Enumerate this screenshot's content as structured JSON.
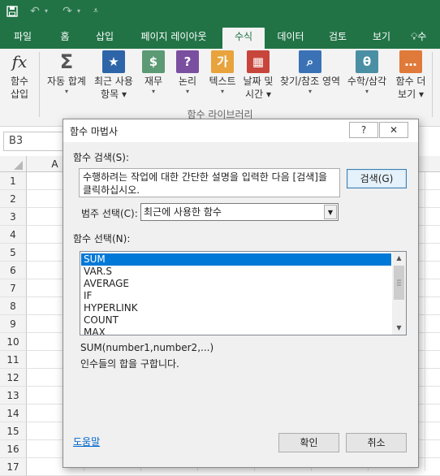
{
  "qat": {
    "save_icon": "save-icon",
    "undo_icon": "undo-icon",
    "redo_icon": "redo-icon"
  },
  "tabs": [
    "파일",
    "홈",
    "삽입",
    "페이지 레이아웃",
    "수식",
    "데이터",
    "검토",
    "보기",
    "수"
  ],
  "active_tab": "수식",
  "ribbon": {
    "insert_function": {
      "line1": "함수",
      "line2": "삽입",
      "icon": "fx"
    },
    "autosum": {
      "label": "자동 합계",
      "icon": "Σ"
    },
    "recent": {
      "line1": "최근 사용",
      "line2": "항목",
      "icon": "★"
    },
    "financial": {
      "label": "재무",
      "icon": "$"
    },
    "logical": {
      "label": "논리",
      "icon": "?"
    },
    "text": {
      "label": "텍스트",
      "icon": "가"
    },
    "datetime": {
      "line1": "날짜 및",
      "line2": "시간",
      "icon": "▦"
    },
    "lookup": {
      "label": "찾기/참조 영역",
      "icon": "⌕"
    },
    "math": {
      "label": "수학/삼각",
      "icon": "θ"
    },
    "more": {
      "line1": "함수 더",
      "line2": "보기",
      "icon": "…"
    },
    "group_label": "함수 라이브러리"
  },
  "namebox": {
    "value": "B3"
  },
  "sheet": {
    "column_a": "A",
    "rows": [
      "1",
      "2",
      "3",
      "4",
      "5",
      "6",
      "7",
      "8",
      "9",
      "10",
      "11",
      "12",
      "13",
      "14",
      "15",
      "16",
      "17"
    ]
  },
  "dialog": {
    "title": "함수 마법사",
    "help_button": "?",
    "close_button": "✕",
    "search_label": "함수 검색(S):",
    "search_desc": "수행하려는 작업에 대한 간단한 설명을 입력한 다음 [검색]을 클릭하십시오.",
    "search_button": "검색(G)",
    "category_label": "범주 선택(C):",
    "category_value": "최근에 사용한 함수",
    "function_label": "함수 선택(N):",
    "functions": [
      "SUM",
      "VAR.S",
      "AVERAGE",
      "IF",
      "HYPERLINK",
      "COUNT",
      "MAX"
    ],
    "selected_function": "SUM",
    "syntax": "SUM(number1,number2,...)",
    "description": "인수들의 합을 구합니다.",
    "help_link": "도움말",
    "ok_button": "확인",
    "cancel_button": "취소"
  },
  "colors": {
    "excel_green": "#217346",
    "selection_blue": "#0078d7"
  }
}
